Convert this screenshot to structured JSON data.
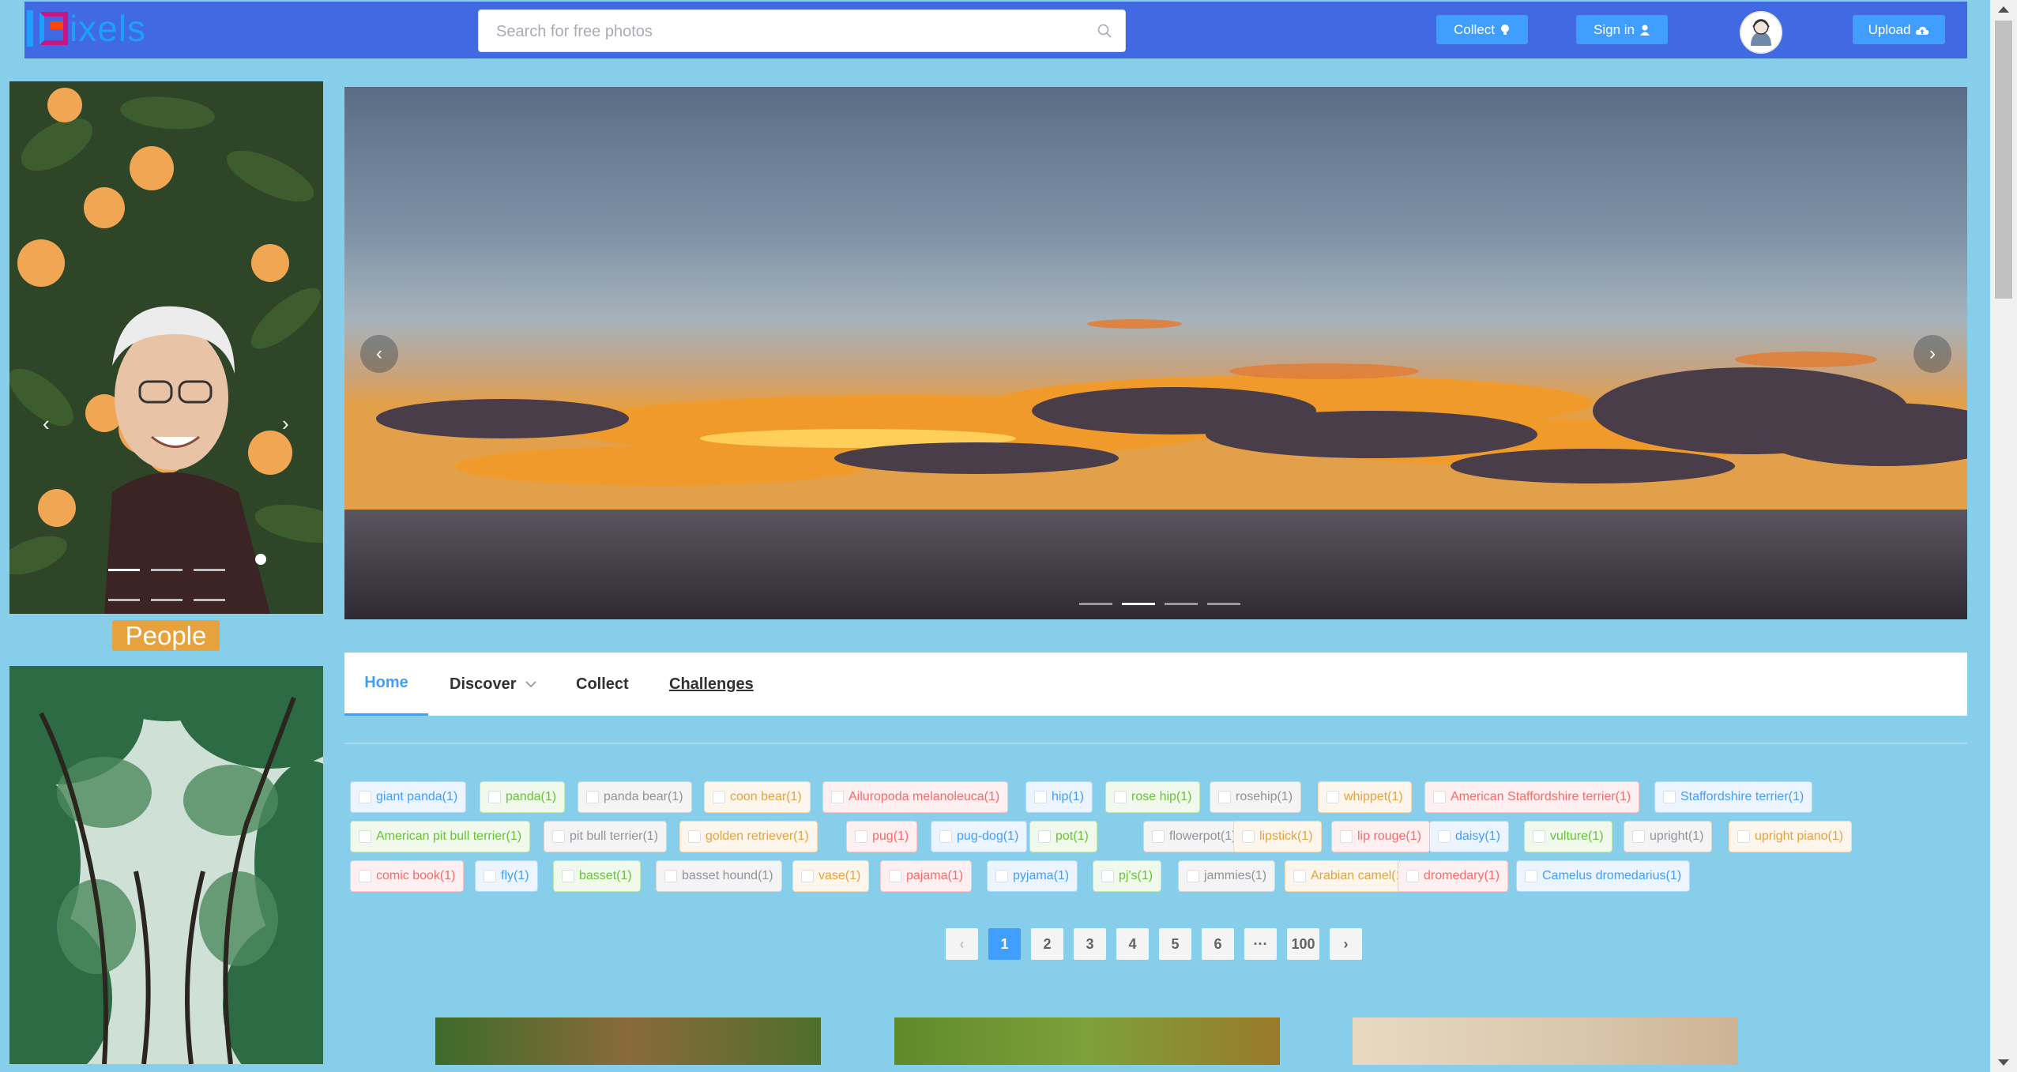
{
  "brand": {
    "name": "ixels",
    "colors": {
      "header": "#4169e1",
      "page": "#87ceeb",
      "accent": "#409eff",
      "label": "#e6a23c"
    }
  },
  "search": {
    "placeholder": "Search for free photos",
    "value": "",
    "icon": "search-icon"
  },
  "header": {
    "collect_label": "Collect",
    "collect_icon": "lightbulb-icon",
    "signin_label": "Sign in",
    "signin_icon": "user-icon",
    "upload_label": "Upload",
    "upload_icon": "cloud-upload-icon",
    "avatar_icon": "avatar-icon"
  },
  "side_carousel": {
    "caption": "People",
    "prev_icon": "chevron-left-icon",
    "next_icon": "chevron-right-icon",
    "indicator_count": 3,
    "active_index": 0
  },
  "main_carousel": {
    "prev_icon": "chevron-left-icon",
    "next_icon": "chevron-right-icon",
    "indicator_count": 4,
    "active_index": 1
  },
  "nav": {
    "tabs": [
      {
        "label": "Home",
        "active": true
      },
      {
        "label": "Discover",
        "dropdown": true
      },
      {
        "label": "Collect"
      },
      {
        "label": "Challenges"
      }
    ]
  },
  "tags": [
    {
      "label": "giant panda(1)",
      "color": "blue"
    },
    {
      "label": "panda(1)",
      "color": "green"
    },
    {
      "label": "panda bear(1)",
      "color": "gray"
    },
    {
      "label": "coon bear(1)",
      "color": "orange"
    },
    {
      "label": "Ailuropoda melanoleuca(1)",
      "color": "red"
    },
    {
      "label": "hip(1)",
      "color": "blue"
    },
    {
      "label": "rose hip(1)",
      "color": "green"
    },
    {
      "label": "rosehip(1)",
      "color": "gray"
    },
    {
      "label": "whippet(1)",
      "color": "orange"
    },
    {
      "label": "American Staffordshire terrier(1)",
      "color": "red"
    },
    {
      "label": "Staffordshire terrier(1)",
      "color": "blue"
    },
    {
      "label": "American pit bull terrier(1)",
      "color": "green"
    },
    {
      "label": "pit bull terrier(1)",
      "color": "gray"
    },
    {
      "label": "golden retriever(1)",
      "color": "orange"
    },
    {
      "label": "pug(1)",
      "color": "red"
    },
    {
      "label": "pug-dog(1)",
      "color": "blue"
    },
    {
      "label": "pot(1)",
      "color": "green"
    },
    {
      "label": "flowerpot(1)",
      "color": "gray"
    },
    {
      "label": "lipstick(1)",
      "color": "orange"
    },
    {
      "label": "lip rouge(1)",
      "color": "red"
    },
    {
      "label": "daisy(1)",
      "color": "blue"
    },
    {
      "label": "vulture(1)",
      "color": "green"
    },
    {
      "label": "upright(1)",
      "color": "gray"
    },
    {
      "label": "upright piano(1)",
      "color": "orange"
    },
    {
      "label": "comic book(1)",
      "color": "red"
    },
    {
      "label": "fly(1)",
      "color": "blue"
    },
    {
      "label": "basset(1)",
      "color": "green"
    },
    {
      "label": "basset hound(1)",
      "color": "gray"
    },
    {
      "label": "vase(1)",
      "color": "orange"
    },
    {
      "label": "pajama(1)",
      "color": "red"
    },
    {
      "label": "pyjama(1)",
      "color": "blue"
    },
    {
      "label": "pj's(1)",
      "color": "green"
    },
    {
      "label": "jammies(1)",
      "color": "gray"
    },
    {
      "label": "Arabian camel(1)",
      "color": "orange"
    },
    {
      "label": "dromedary(1)",
      "color": "red"
    },
    {
      "label": "Camelus dromedarius(1)",
      "color": "blue"
    }
  ],
  "pagination": {
    "prev_icon": "chevron-left-icon",
    "next_icon": "chevron-right-icon",
    "pages": [
      "1",
      "2",
      "3",
      "4",
      "5",
      "6",
      "···",
      "100"
    ],
    "current": "1"
  }
}
